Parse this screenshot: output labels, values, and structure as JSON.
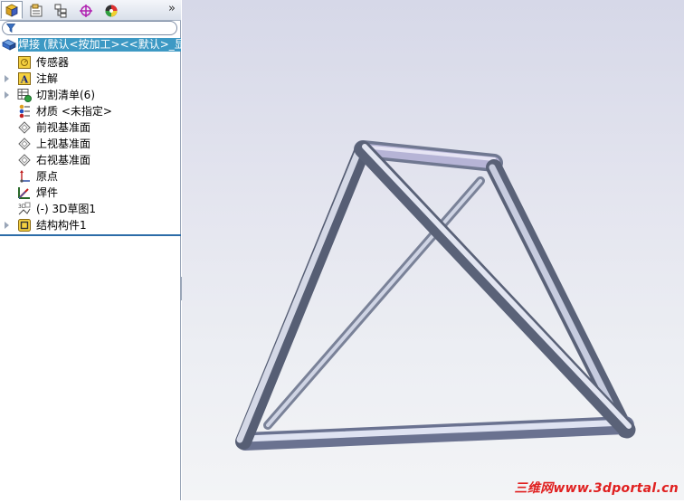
{
  "toolbar": {
    "more": "»"
  },
  "tree": {
    "root_label": "焊接 (默认<按加工><<默认>_显",
    "items": [
      {
        "label": "传感器",
        "icon": "sensor-icon",
        "expandable": false
      },
      {
        "label": "注解",
        "icon": "annotation-icon",
        "expandable": true
      },
      {
        "label": "切割清单(6)",
        "icon": "cut-list-icon",
        "expandable": true
      },
      {
        "label": "材质 <未指定>",
        "icon": "material-icon",
        "expandable": false
      },
      {
        "label": "前视基准面",
        "icon": "plane-icon",
        "expandable": false
      },
      {
        "label": "上视基准面",
        "icon": "plane-icon",
        "expandable": false
      },
      {
        "label": "右视基准面",
        "icon": "plane-icon",
        "expandable": false
      },
      {
        "label": "原点",
        "icon": "origin-icon",
        "expandable": false
      },
      {
        "label": "焊件",
        "icon": "weldment-icon",
        "expandable": false
      },
      {
        "label": "(-) 3D草图1",
        "icon": "3d-sketch-icon",
        "expandable": false
      },
      {
        "label": "结构构件1",
        "icon": "structural-member-icon",
        "expandable": true
      }
    ]
  },
  "watermark": "三维网www.3dportal.cn",
  "colors": {
    "selection": "#3d99c4",
    "tube": "#a9b3cc",
    "watermark": "#e02020"
  }
}
